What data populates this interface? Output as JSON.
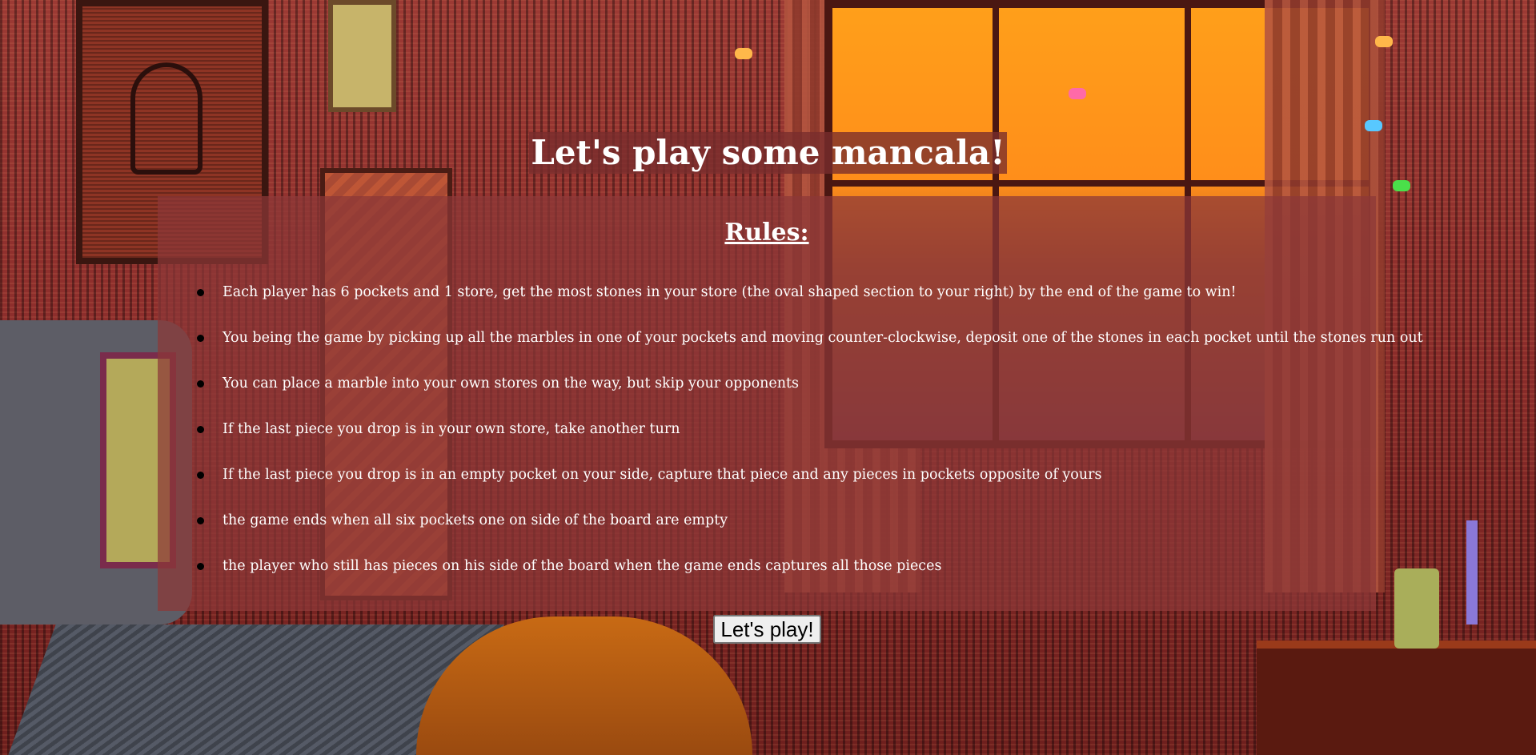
{
  "page": {
    "title": "Let's play some mancala!"
  },
  "rules": {
    "heading": "Rules:",
    "items": [
      "Each player has 6 pockets and 1 store, get the most stones in your store (the oval shaped section to your right) by the end of the game to win!",
      "You being the game by picking up all the marbles in one of your pockets and moving counter-clockwise, deposit one of the stones in each pocket until the stones run out",
      "You can place a marble into your own stores on the way, but skip your opponents",
      "If the last piece you drop is in your own store, take another turn",
      "If the last piece you drop is in an empty pocket on your side, capture that piece and any pieces in pockets opposite of yours",
      "the game ends when all six pockets one on side of the board are empty",
      "the player who still has pieces on his side of the board when the game ends captures all those pieces"
    ]
  },
  "actions": {
    "play_label": "Let's play!"
  },
  "colors": {
    "panel": "#8c3737",
    "title_bg": "#782d2d",
    "text": "#ffffff"
  },
  "background": {
    "icon": "pixel-art-bedroom-scene"
  }
}
